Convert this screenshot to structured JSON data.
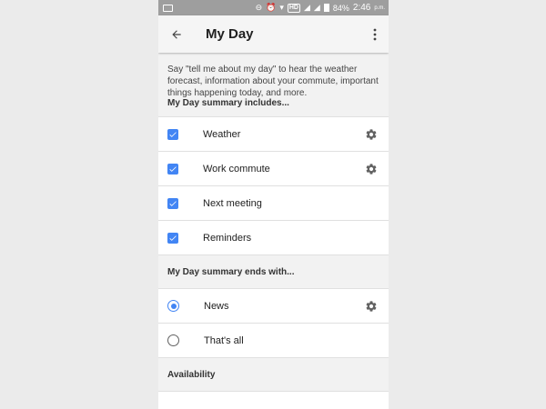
{
  "status_bar": {
    "hd": "HD",
    "battery": "84%",
    "time": "2:46",
    "ampm": "p.m."
  },
  "app_bar": {
    "title": "My Day"
  },
  "description": "Say \"tell me about my day\" to hear the weather forecast, information about your commute, important things happening today, and more.",
  "includes": {
    "heading": "My Day summary includes...",
    "items": [
      {
        "label": "Weather",
        "checked": true,
        "has_settings": true
      },
      {
        "label": "Work commute",
        "checked": true,
        "has_settings": true
      },
      {
        "label": "Next meeting",
        "checked": true,
        "has_settings": false
      },
      {
        "label": "Reminders",
        "checked": true,
        "has_settings": false
      }
    ]
  },
  "ends_with": {
    "heading": "My Day summary ends with...",
    "options": [
      {
        "label": "News",
        "selected": true,
        "has_settings": true
      },
      {
        "label": "That's all",
        "selected": false,
        "has_settings": false
      }
    ]
  },
  "availability": {
    "heading": "Availability"
  },
  "colors": {
    "accent": "#4285f4",
    "status_bar": "#9e9e9e",
    "background": "#f2f2f2"
  }
}
